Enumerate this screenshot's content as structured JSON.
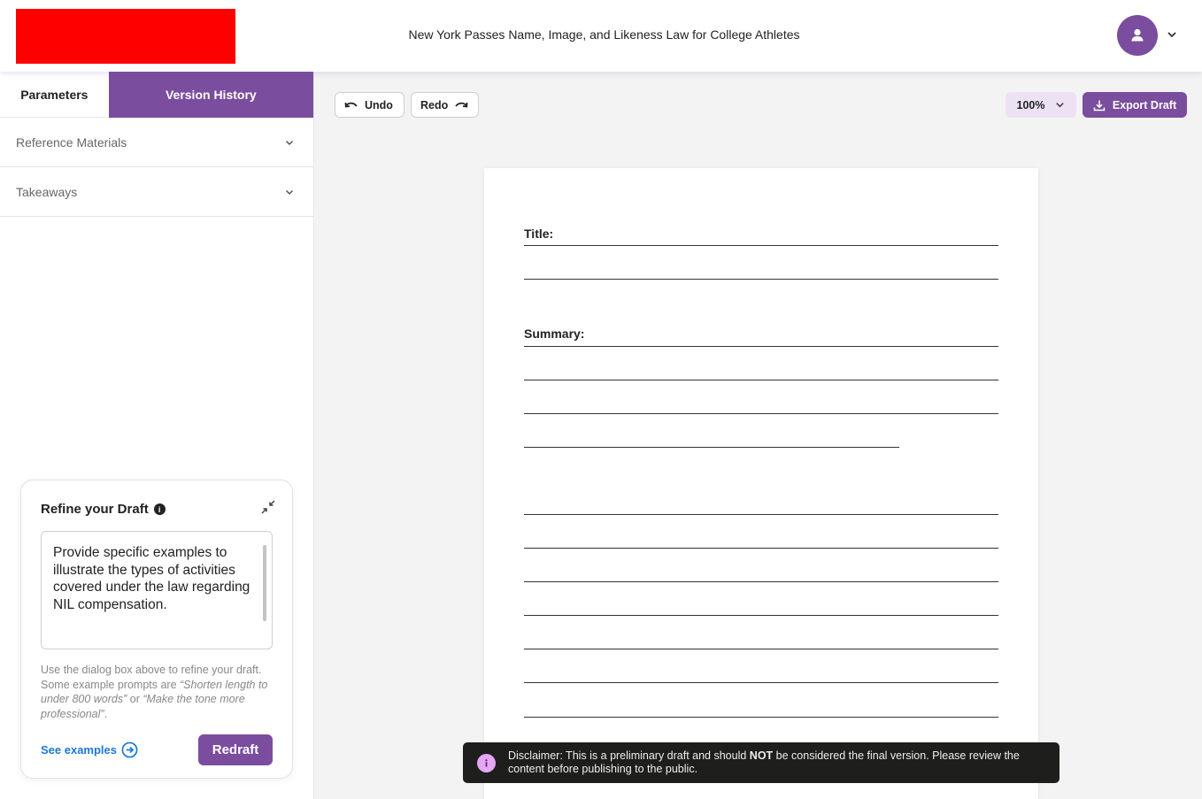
{
  "colors": {
    "brand": "#7a4d9e",
    "logo_placeholder": "#ff0000",
    "link": "#1a79d8",
    "zoom_bg": "#ede2f4",
    "disclaimer_bg": "#1e1e1c",
    "disclaimer_icon": "#e6a7f5"
  },
  "header": {
    "document_title": "New York Passes Name, Image, and Likeness Law for College Athletes",
    "avatar_icon": "user-icon",
    "menu_icon": "chevron-down-icon"
  },
  "sidebar": {
    "tabs": [
      {
        "label": "Parameters",
        "active": true
      },
      {
        "label": "Version History",
        "active": false
      }
    ],
    "accordions": [
      {
        "label": "Reference Materials",
        "expanded": false
      },
      {
        "label": "Takeaways",
        "expanded": false
      }
    ]
  },
  "refine": {
    "title": "Refine your Draft",
    "prompt_value": "Provide specific examples to illustrate the types of activities covered under the law regarding NIL compensation.",
    "helper_text": "Use the dialog box above to refine your draft. Some example prompts are ",
    "helper_example_1": "“Shorten length to under 800 words”",
    "helper_or": " or ",
    "helper_example_2": "“Make the tone more professional”",
    "helper_end": ".",
    "see_examples_label": "See examples",
    "redraft_label": "Redraft"
  },
  "toolbar": {
    "undo_label": "Undo",
    "redo_label": "Redo",
    "zoom_value": "100%",
    "export_label": "Export Draft"
  },
  "document": {
    "title_label": "Title:",
    "summary_label": "Summary:"
  },
  "disclaimer": {
    "prefix": "Disclaimer: This is a preliminary draft and should ",
    "emphasis": "NOT",
    "suffix": " be considered the final version. Please review the content before publishing to the public."
  }
}
